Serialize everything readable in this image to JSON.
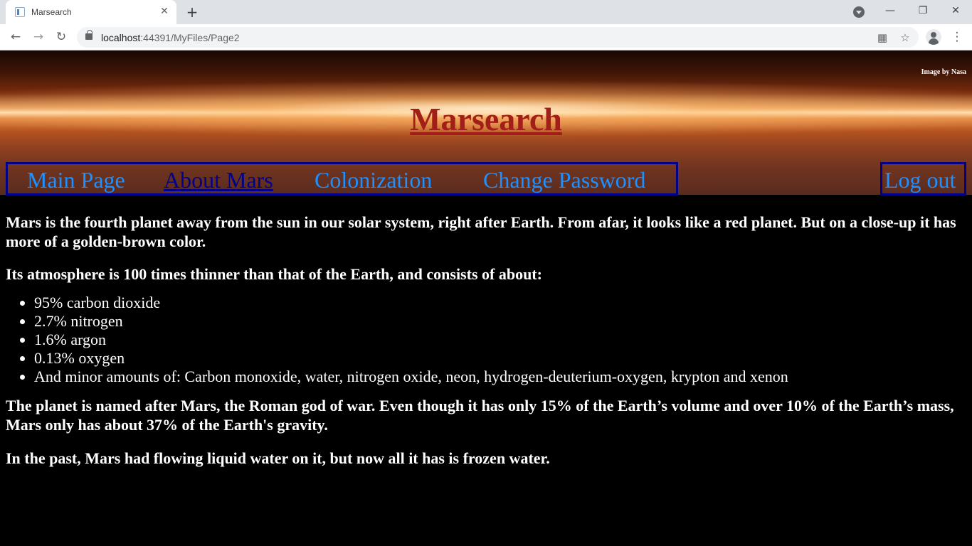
{
  "browser": {
    "tab_title": "Marsearch",
    "tab_close": "✕",
    "new_tab": "+",
    "url_host": "localhost",
    "url_path": ":44391/MyFiles/Page2",
    "minimize": "—",
    "restore": "❐",
    "close": "✕"
  },
  "header": {
    "credit": "Image by Nasa",
    "title": "Marsearch"
  },
  "nav": {
    "items": [
      {
        "label": "Main Page"
      },
      {
        "label": "About Mars"
      },
      {
        "label": "Colonization"
      },
      {
        "label": "Change Password"
      }
    ],
    "active_index": 1,
    "logout": "Log out"
  },
  "content": {
    "p1": "Mars is the fourth planet away from the sun in our solar system, right after Earth. From afar, it looks like a red planet. But on a close-up it has more of a golden-brown color.",
    "p2": "Its atmosphere is 100 times thinner than that of the Earth, and consists of about:",
    "list": [
      "95% carbon dioxide",
      "2.7% nitrogen",
      "1.6% argon",
      "0.13% oxygen",
      "And minor amounts of: Carbon monoxide, water, nitrogen oxide, neon, hydrogen-deuterium-oxygen, krypton and xenon"
    ],
    "p3": "The planet is named after Mars, the Roman god of war. Even though it has only 15% of the Earth’s volume and over 10% of the Earth’s mass, Mars only has about 37% of the Earth's gravity.",
    "p4": "In the past, Mars had flowing liquid water on it, but now all it has is frozen water."
  },
  "colors": {
    "title": "#a21f19",
    "nav_link": "#1e90ff",
    "nav_active": "#00008b",
    "nav_border": "#00008b",
    "page_bg": "#000000"
  }
}
